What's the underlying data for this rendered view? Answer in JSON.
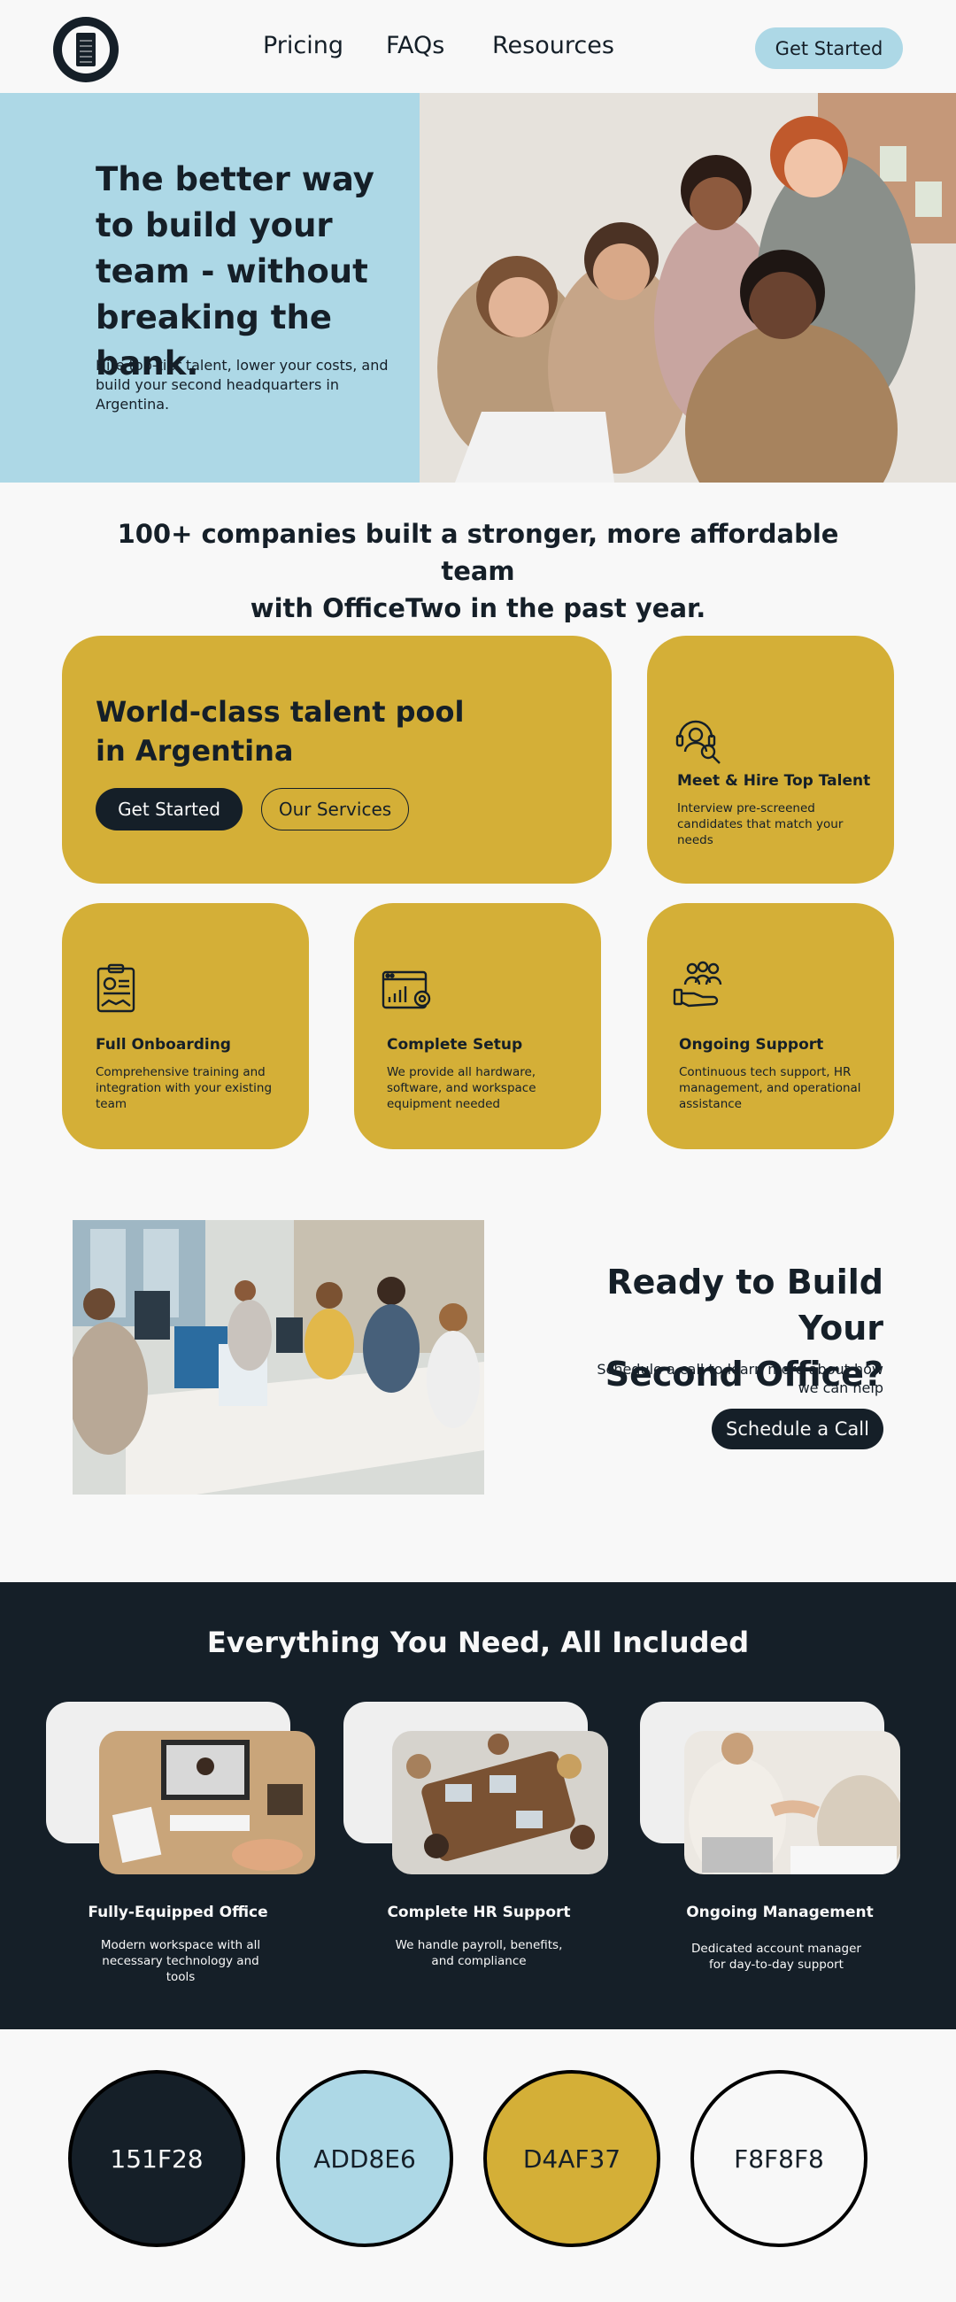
{
  "nav": {
    "logo": "building-logo",
    "links": [
      "Pricing",
      "FAQs",
      "Resources"
    ],
    "cta_label": "Get Started"
  },
  "hero": {
    "title": "The better way to build your team - without breaking the bank.",
    "subtitle": "Hire top-tier talent, lower your costs, and build your second headquarters in Argentina.",
    "image": "team-laptop-photo"
  },
  "stats": {
    "line1": "100+ companies built a stronger, more affordable team",
    "line2": "with OfficeTwo in the past year."
  },
  "talent": {
    "title": "World-class talent pool in Argentina",
    "primary_label": "Get Started",
    "secondary_label": "Our Services"
  },
  "services": [
    {
      "icon": "headset-team-icon",
      "title": "Meet & Hire Top Talent",
      "desc": "Interview pre-screened candidates that match your needs"
    },
    {
      "icon": "clipboard-handshake-icon",
      "title": "Full Onboarding",
      "desc": "Comprehensive training and integration with your existing team"
    },
    {
      "icon": "browser-gear-chart-icon",
      "title": "Complete Setup",
      "desc": "We provide all hardware, software, and workspace equipment needed"
    },
    {
      "icon": "hand-people-icon",
      "title": "Ongoing Support",
      "desc": "Continuous tech support, HR management, and operational assistance"
    }
  ],
  "ready": {
    "title_line1": "Ready to Build Your",
    "title_line2": "Second Office?",
    "subtitle": "Schedule a call to learn more about how we can help",
    "cta_label": "Schedule a Call",
    "image": "office-workers-photo"
  },
  "included": {
    "title": "Everything You Need, All Included",
    "features": [
      {
        "image": "desk-videocall-photo",
        "title": "Fully-Equipped Office",
        "desc": "Modern workspace with all necessary technology and tools"
      },
      {
        "image": "meeting-table-photo",
        "title": "Complete HR Support",
        "desc": "We handle payroll, benefits, and compliance"
      },
      {
        "image": "handshake-photo",
        "title": "Ongoing Management",
        "desc": "Dedicated account manager for day-to-day support"
      }
    ]
  },
  "palette": [
    {
      "label": "151F28",
      "color": "#151F28",
      "text_color": "#F8F8F8"
    },
    {
      "label": "ADD8E6",
      "color": "#ADD8E6",
      "text_color": "#151F28"
    },
    {
      "label": "D4AF37",
      "color": "#D4AF37",
      "text_color": "#151F28"
    },
    {
      "label": "F8F8F8",
      "color": "#F8F8F8",
      "text_color": "#151F28"
    }
  ]
}
